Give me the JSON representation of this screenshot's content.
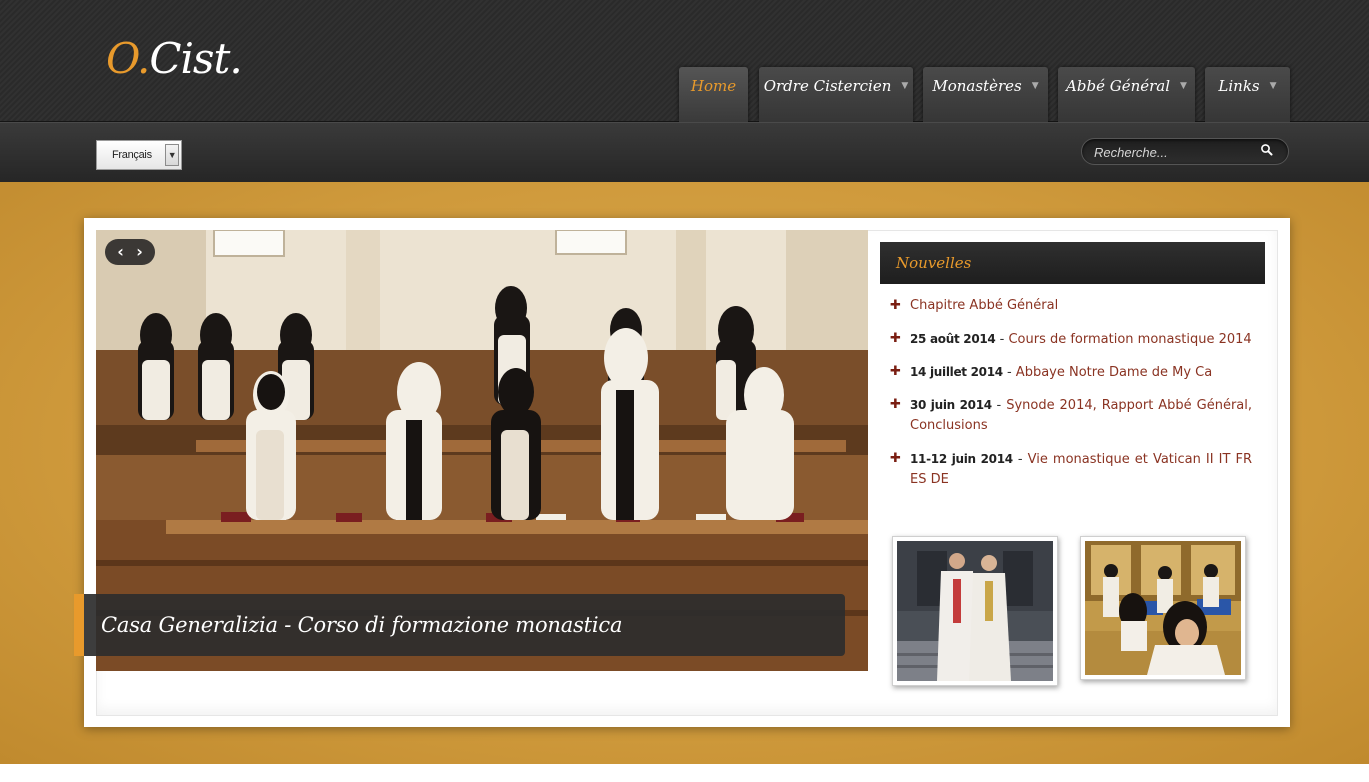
{
  "header": {
    "logo": {
      "prefix": "O.",
      "suffix": "Cist."
    },
    "nav": [
      {
        "label": "Home",
        "active": true,
        "has_dropdown": false
      },
      {
        "label": "Ordre Cistercien",
        "active": false,
        "has_dropdown": true
      },
      {
        "label": "Monastères",
        "active": false,
        "has_dropdown": true
      },
      {
        "label": "Abbé Général",
        "active": false,
        "has_dropdown": true
      },
      {
        "label": "Links",
        "active": false,
        "has_dropdown": true
      }
    ]
  },
  "subheader": {
    "language": {
      "selected": "Français"
    },
    "search": {
      "placeholder": "Recherche..."
    }
  },
  "slider": {
    "prev_label": "‹",
    "next_label": "›",
    "caption": "Casa Generalizia - Corso di formazione monastica"
  },
  "news": {
    "title": "Nouvelles",
    "items": [
      {
        "date": "",
        "title": "Chapitre Abbé Général"
      },
      {
        "date": "25 août 2014",
        "title": "Cours de formation monastique 2014"
      },
      {
        "date": "14 juillet 2014",
        "title": "Abbaye Notre Dame de My Ca"
      },
      {
        "date": "30 juin 2014 ",
        "title": "Synode 2014, Rapport Abbé Général, Conclusions"
      },
      {
        "date": "11-12 juin 2014",
        "title": "Vie monastique et Vatican II IT FR ES DE"
      }
    ]
  },
  "colors": {
    "accent": "#e89a2c",
    "header_dark": "#2c2c2c",
    "gold": "#cf9a3c",
    "link": "#8a3322"
  },
  "icons": {
    "search": "search-icon",
    "plus": "plus-icon",
    "chevron": "chevron-down-icon"
  }
}
